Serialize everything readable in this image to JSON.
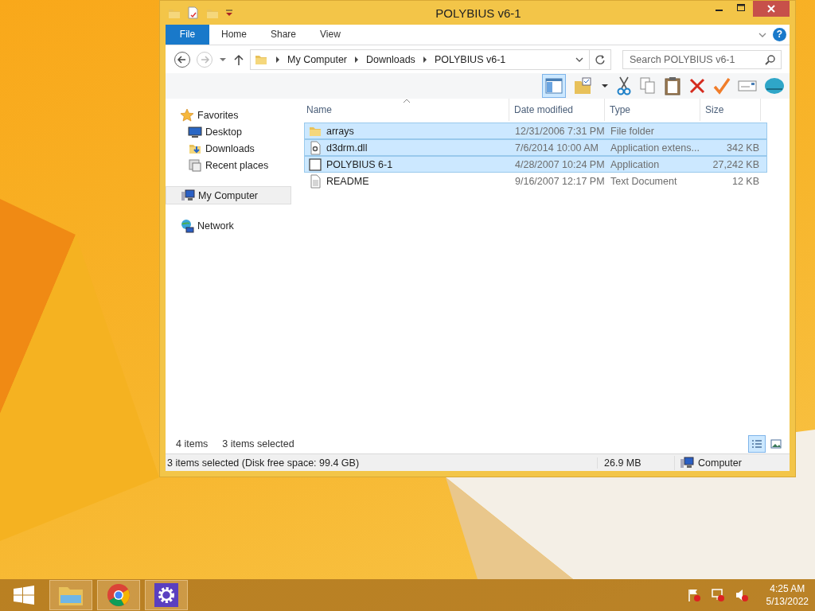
{
  "window": {
    "title": "POLYBIUS v6-1"
  },
  "ribbon": {
    "tabs": [
      {
        "label": "File",
        "kind": "file"
      },
      {
        "label": "Home",
        "kind": "tab"
      },
      {
        "label": "Share",
        "kind": "tab"
      },
      {
        "label": "View",
        "kind": "tab"
      }
    ],
    "help": "?"
  },
  "address": {
    "crumbs": [
      "My Computer",
      "Downloads",
      "POLYBIUS v6-1"
    ],
    "search": {
      "placeholder": "Search POLYBIUS v6-1"
    }
  },
  "toolbar": {
    "preview_pane_on": true
  },
  "nav": [
    {
      "label": "Favorites",
      "kind": "favorites",
      "selected": false,
      "children": [
        {
          "label": "Desktop",
          "kind": "desktop",
          "selected": false
        },
        {
          "label": "Downloads",
          "kind": "downloads",
          "selected": false
        },
        {
          "label": "Recent places",
          "kind": "recent",
          "selected": false
        }
      ]
    },
    {
      "label": "My Computer",
      "kind": "computer",
      "selected": true
    },
    {
      "label": "Network",
      "kind": "network",
      "selected": false
    }
  ],
  "table": {
    "columns": [
      {
        "label": "Name",
        "sorted": true
      },
      {
        "label": "Date modified",
        "sorted": false
      },
      {
        "label": "Type",
        "sorted": false
      },
      {
        "label": "Size",
        "sorted": false
      }
    ],
    "rows": [
      {
        "name": "arrays",
        "date": "12/31/2006 7:31 PM",
        "type": "File folder",
        "size": "",
        "kind": "folder",
        "selected": true
      },
      {
        "name": "d3drm.dll",
        "date": "7/6/2014 10:00 AM",
        "type": "Application extens...",
        "size": "342 KB",
        "kind": "dll",
        "selected": true
      },
      {
        "name": "POLYBIUS 6-1",
        "date": "4/28/2007 10:24 PM",
        "type": "Application",
        "size": "27,242 KB",
        "kind": "app",
        "selected": true
      },
      {
        "name": "README",
        "date": "9/16/2007 12:17 PM",
        "type": "Text Document",
        "size": "12 KB",
        "kind": "text",
        "selected": false
      }
    ]
  },
  "info": {
    "count": "4 items",
    "selection": "3 items selected",
    "views": [
      {
        "kind": "details",
        "selected": true
      },
      {
        "kind": "large",
        "selected": false
      }
    ]
  },
  "status_bar": {
    "text": "3 items selected (Disk free space: 99.4 GB)",
    "size": "26.9 MB",
    "location": "Computer"
  },
  "taskbar": {
    "apps": [
      {
        "kind": "explorer"
      },
      {
        "kind": "chrome"
      },
      {
        "kind": "settings"
      }
    ],
    "time": "4:25 AM",
    "date": "5/13/2022"
  }
}
